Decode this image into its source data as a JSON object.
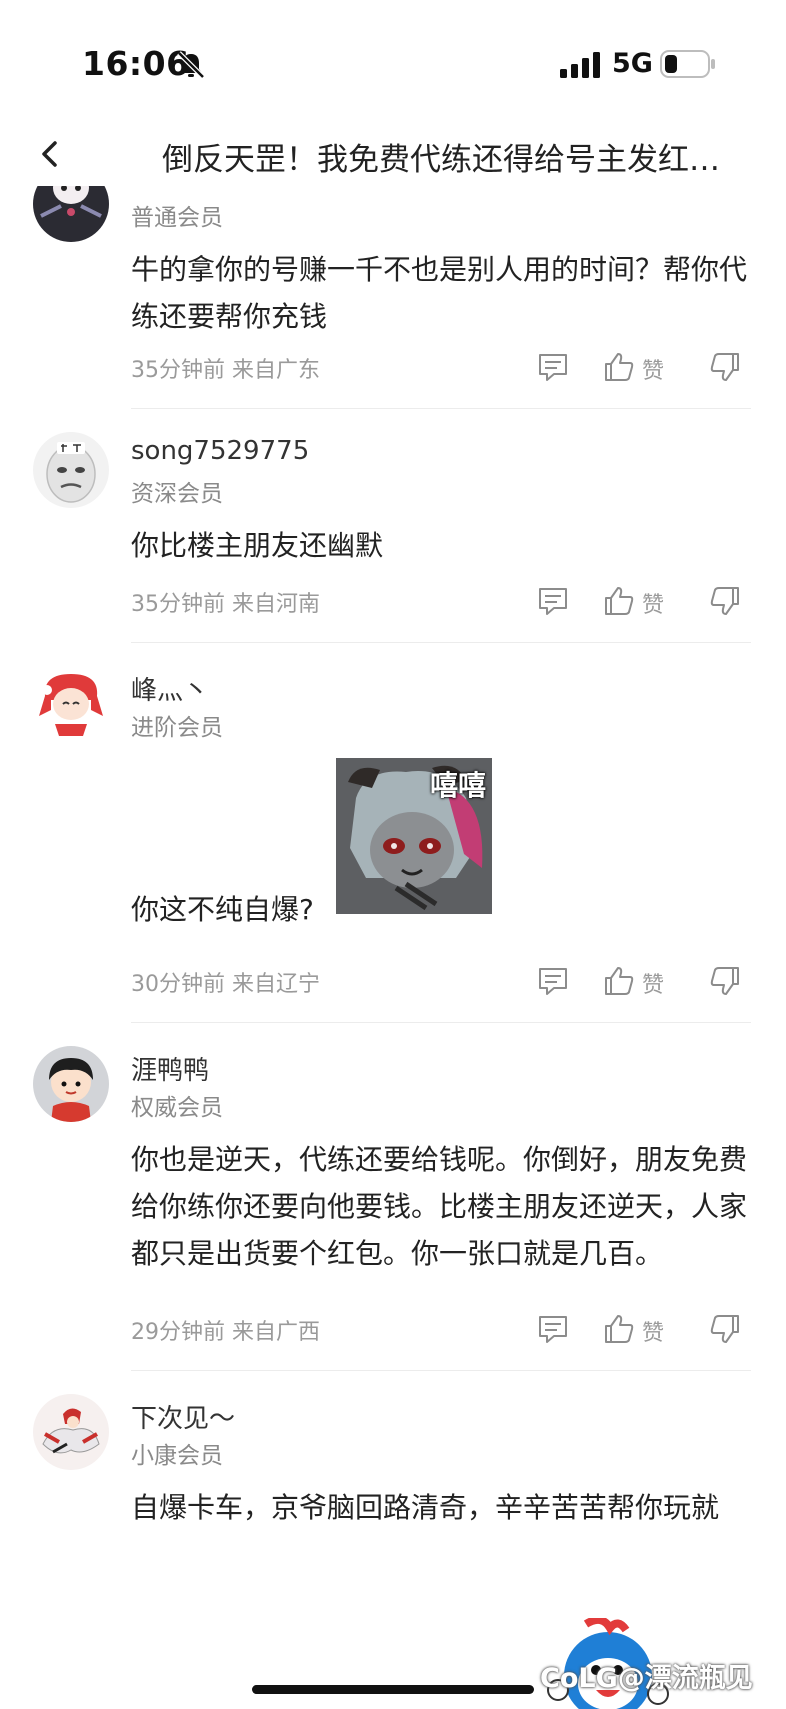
{
  "status_bar": {
    "time": "16:06",
    "network": "5G",
    "icons": [
      "bell-slash-icon",
      "signal-icon",
      "battery-icon"
    ]
  },
  "header": {
    "title": "倒反天罡！我免费代练还得给号主发红…",
    "back_icon": "chevron-left-icon"
  },
  "comments": [
    {
      "username": "",
      "member": "普通会员",
      "content": "牛的拿你的号赚一千不也是别人用的时间？帮你代练还要帮你充钱",
      "time": "35分钟前",
      "location": "来自广东",
      "like_label": "赞"
    },
    {
      "username": "song7529775",
      "member": "资深会员",
      "content": "你比楼主朋友还幽默",
      "time": "35分钟前",
      "location": "来自河南",
      "like_label": "赞"
    },
    {
      "username": "峰灬丶",
      "member": "进阶会员",
      "content": "你这不纯自爆?",
      "sticker_text": "嘻嘻",
      "time": "30分钟前",
      "location": "来自辽宁",
      "like_label": "赞"
    },
    {
      "username": "涯鸭鸭",
      "member": "权威会员",
      "content": "你也是逆天，代练还要给钱呢。你倒好，朋友免费给你练你还要向他要钱。比楼主朋友还逆天，人家都只是出货要个红包。你一张口就是几百。",
      "time": "29分钟前",
      "location": "来自广西",
      "like_label": "赞"
    },
    {
      "username": "下次见～",
      "member": "小康会员",
      "content": "自爆卡车，京爷脑回路清奇，辛辛苦苦帮你玩就"
    }
  ],
  "watermark": "CoLG@漂流瓶见",
  "colors": {
    "text": "#222222",
    "secondary": "#8a8a8a",
    "divider": "#ececec",
    "background": "#ffffff"
  }
}
